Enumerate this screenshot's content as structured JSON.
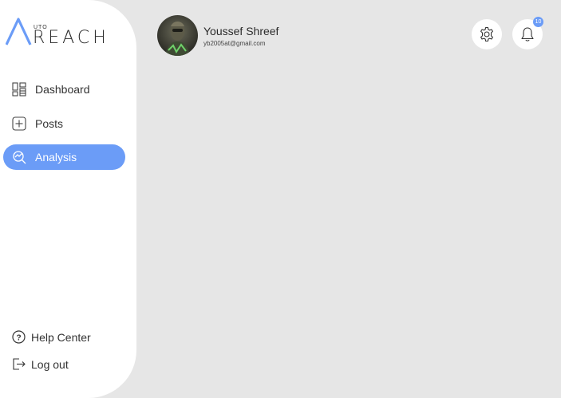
{
  "brand": {
    "prefix_small": "UTO",
    "main": "REACH"
  },
  "sidebar": {
    "items": [
      {
        "label": "Dashboard",
        "icon": "dashboard-icon",
        "active": false
      },
      {
        "label": "Posts",
        "icon": "plus-square-icon",
        "active": false
      },
      {
        "label": "Analysis",
        "icon": "analysis-icon",
        "active": true
      }
    ],
    "bottom": [
      {
        "label": "Help Center",
        "icon": "help-icon"
      },
      {
        "label": "Log out",
        "icon": "logout-icon"
      }
    ]
  },
  "user": {
    "name": "Youssef Shreef",
    "email": "yb2005at@gmail.com"
  },
  "header": {
    "notification_count": "10"
  },
  "colors": {
    "accent": "#6b9cf7",
    "background": "#e6e6e6",
    "sidebar": "#ffffff"
  }
}
